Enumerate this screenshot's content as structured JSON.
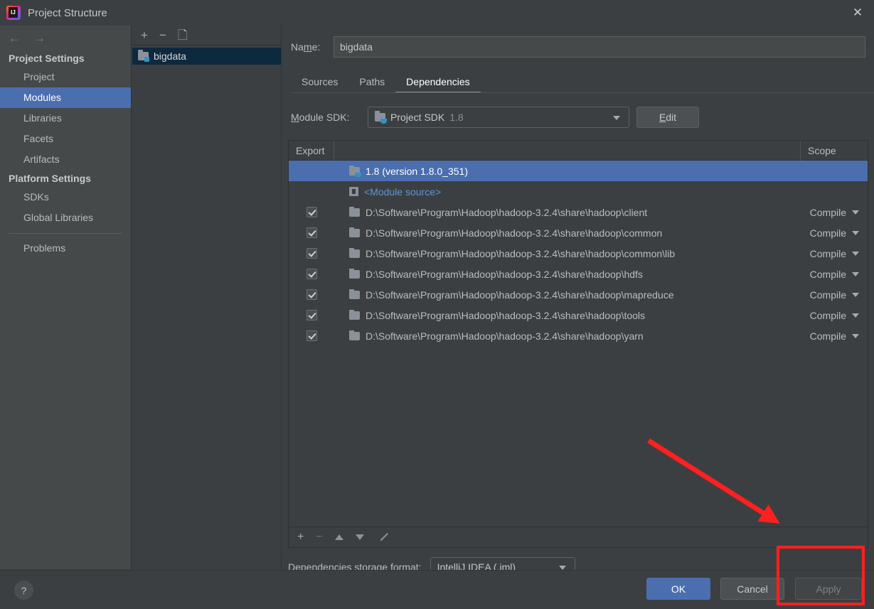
{
  "window": {
    "title": "Project Structure",
    "logo_icon": "intellij-idea-logo",
    "close_icon": "close-icon"
  },
  "sidebar": {
    "back_icon": "arrow-left-icon",
    "forward_icon": "arrow-right-icon",
    "groups": [
      {
        "label": "Project Settings",
        "items": [
          {
            "label": "Project",
            "selected": false
          },
          {
            "label": "Modules",
            "selected": true
          },
          {
            "label": "Libraries",
            "selected": false
          },
          {
            "label": "Facets",
            "selected": false
          },
          {
            "label": "Artifacts",
            "selected": false
          }
        ]
      },
      {
        "label": "Platform Settings",
        "items": [
          {
            "label": "SDKs",
            "selected": false
          },
          {
            "label": "Global Libraries",
            "selected": false
          }
        ]
      }
    ],
    "extra_items": [
      {
        "label": "Problems",
        "selected": false
      }
    ]
  },
  "modules_panel": {
    "toolbar": {
      "add_icon": "plus-icon",
      "remove_icon": "minus-icon",
      "copy_icon": "copy-icon"
    },
    "items": [
      {
        "label": "bigdata",
        "selected": true,
        "icon": "module-folder-icon"
      }
    ]
  },
  "content": {
    "name_label": "Name:",
    "name_value": "bigdata",
    "name_placeholder": "",
    "tabs": [
      {
        "label": "Sources",
        "active": false
      },
      {
        "label": "Paths",
        "active": false
      },
      {
        "label": "Dependencies",
        "active": true
      }
    ],
    "sdk_label": "Module SDK:",
    "sdk_name": "Project SDK",
    "sdk_version": "1.8",
    "sdk_caret_icon": "chevron-down-icon",
    "edit_button": "Edit",
    "table": {
      "columns": [
        "Export",
        "",
        "Scope"
      ],
      "rows": [
        {
          "export": null,
          "icon": "jdk-icon",
          "name": "1.8 (version 1.8.0_351)",
          "scope": "",
          "selected": true,
          "link": false
        },
        {
          "export": null,
          "icon": "module-source-icon",
          "name": "<Module source>",
          "scope": "",
          "selected": false,
          "link": true
        },
        {
          "export": true,
          "icon": "folder-icon",
          "name": "D:\\Software\\Program\\Hadoop\\hadoop-3.2.4\\share\\hadoop\\client",
          "scope": "Compile",
          "selected": false,
          "link": false
        },
        {
          "export": true,
          "icon": "folder-icon",
          "name": "D:\\Software\\Program\\Hadoop\\hadoop-3.2.4\\share\\hadoop\\common",
          "scope": "Compile",
          "selected": false,
          "link": false
        },
        {
          "export": true,
          "icon": "folder-icon",
          "name": "D:\\Software\\Program\\Hadoop\\hadoop-3.2.4\\share\\hadoop\\common\\lib",
          "scope": "Compile",
          "selected": false,
          "link": false
        },
        {
          "export": true,
          "icon": "folder-icon",
          "name": "D:\\Software\\Program\\Hadoop\\hadoop-3.2.4\\share\\hadoop\\hdfs",
          "scope": "Compile",
          "selected": false,
          "link": false
        },
        {
          "export": true,
          "icon": "folder-icon",
          "name": "D:\\Software\\Program\\Hadoop\\hadoop-3.2.4\\share\\hadoop\\mapreduce",
          "scope": "Compile",
          "selected": false,
          "link": false
        },
        {
          "export": true,
          "icon": "folder-icon",
          "name": "D:\\Software\\Program\\Hadoop\\hadoop-3.2.4\\share\\hadoop\\tools",
          "scope": "Compile",
          "selected": false,
          "link": false
        },
        {
          "export": true,
          "icon": "folder-icon",
          "name": "D:\\Software\\Program\\Hadoop\\hadoop-3.2.4\\share\\hadoop\\yarn",
          "scope": "Compile",
          "selected": false,
          "link": false
        }
      ]
    },
    "table_toolbar": {
      "add_icon": "plus-icon",
      "remove_icon": "minus-icon",
      "up_icon": "triangle-up-icon",
      "down_icon": "triangle-down-icon",
      "edit_icon": "pencil-icon"
    },
    "storage_label": "Dependencies storage format:",
    "storage_value": "IntelliJ IDEA (.iml)"
  },
  "footer": {
    "help_icon": "question-mark-icon",
    "ok": "OK",
    "cancel": "Cancel",
    "apply": "Apply"
  },
  "annotations": {
    "highlight_color": "#fc2020",
    "arrow": "red-arrow-pointing-to-apply",
    "rect": "red-rectangle-around-apply-button"
  }
}
